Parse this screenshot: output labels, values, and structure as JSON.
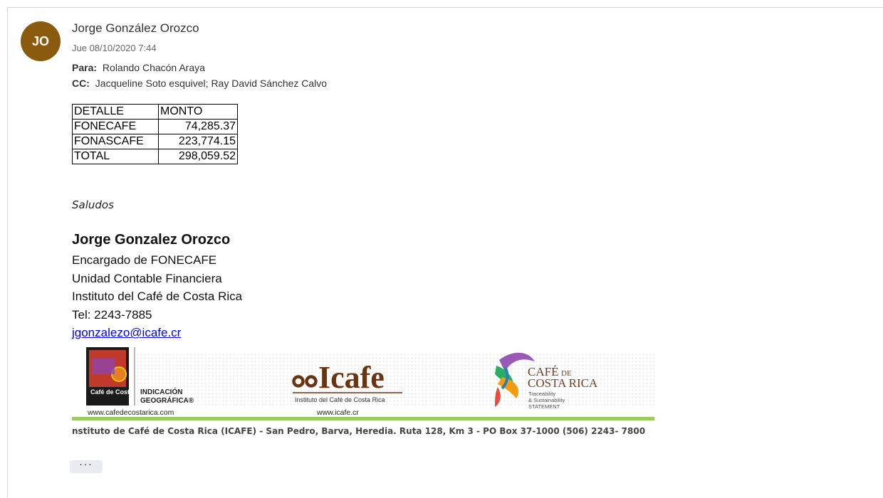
{
  "email": {
    "avatar_initials": "JO",
    "sender": "Jorge González Orozco",
    "date": "Jue 08/10/2020 7:44",
    "to_label": "Para:",
    "to": "Rolando Chacón Araya",
    "cc_label": "CC:",
    "cc": "Jacqueline Soto esquivel; Ray David Sánchez Calvo"
  },
  "table": {
    "headers": [
      "DETALLE",
      "MONTO"
    ],
    "rows": [
      [
        "FONECAFE",
        "74,285.37"
      ],
      [
        "FONASCAFE",
        "223,774.15"
      ],
      [
        "TOTAL",
        "298,059.52"
      ]
    ]
  },
  "greeting": "Saludos",
  "signature": {
    "name": "Jorge Gonzalez Orozco",
    "role": "Encargado de FONECAFE",
    "unit": "Unidad Contable Financiera",
    "org": "Instituto del Café de Costa Rica",
    "tel": "Tel: 2243-7885",
    "email": "jgonzalezo@icafe.cr"
  },
  "banner": {
    "logo1_label": "Café de Costa Rica",
    "ig_line1": "INDICACIÓN",
    "ig_line2": "GEOGRÁFICA®",
    "site1": "www.cafedecostarica.com",
    "icafe_brand": "Icafe",
    "icafe_tag": "Instituto del Café de Costa Rica",
    "site2": "www.icafe.cr",
    "cafe_line1": "CAFÉ",
    "cafe_de": "DE",
    "cafe_line2": "COSTA RICA",
    "trace1": "Traceability",
    "trace2": "& Sustainability",
    "trace3": "STATEMENT"
  },
  "footer_address": "nstituto de Café de Costa Rica (ICAFE) - San Pedro, Barva, Heredia. Ruta 128, Km 3 - PO Box 37-1000   (506) 2243- 7800",
  "more_label": "···",
  "colors": {
    "avatar": "#8a5a0f",
    "icafe_brown": "#6b3410",
    "banner_green": "#9acd5a",
    "link": "#0000ee"
  }
}
